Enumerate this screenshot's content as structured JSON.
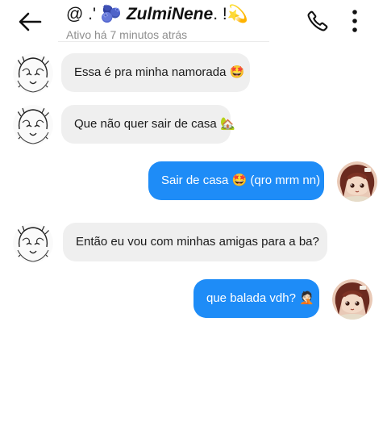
{
  "header": {
    "title_prefix": "@ .' ",
    "title_emoji": "🫐",
    "title_name": " ZulmiNene",
    "title_suffix": ". !💫",
    "status": "Ativo há 7 minutos atrás"
  },
  "icons": {
    "back": "arrow-left",
    "call": "phone",
    "more": "vertical-dots"
  },
  "messages": [
    {
      "direction": "incoming",
      "text": "Essa é pra minha namorada 🤩"
    },
    {
      "direction": "incoming",
      "text": "Que não quer sair de casa 🏡"
    },
    {
      "direction": "outgoing",
      "text": "Sair de casa 🤩 (qro mrm nn)"
    },
    {
      "direction": "incoming",
      "text": "Então eu vou com minhas amigas para a ba?"
    },
    {
      "direction": "outgoing",
      "text": "que balada vdh? 🤦🏻"
    }
  ],
  "colors": {
    "outgoing_bubble": "#1e8cf7",
    "incoming_bubble": "#efefef",
    "status_text": "#8e8e8e"
  }
}
